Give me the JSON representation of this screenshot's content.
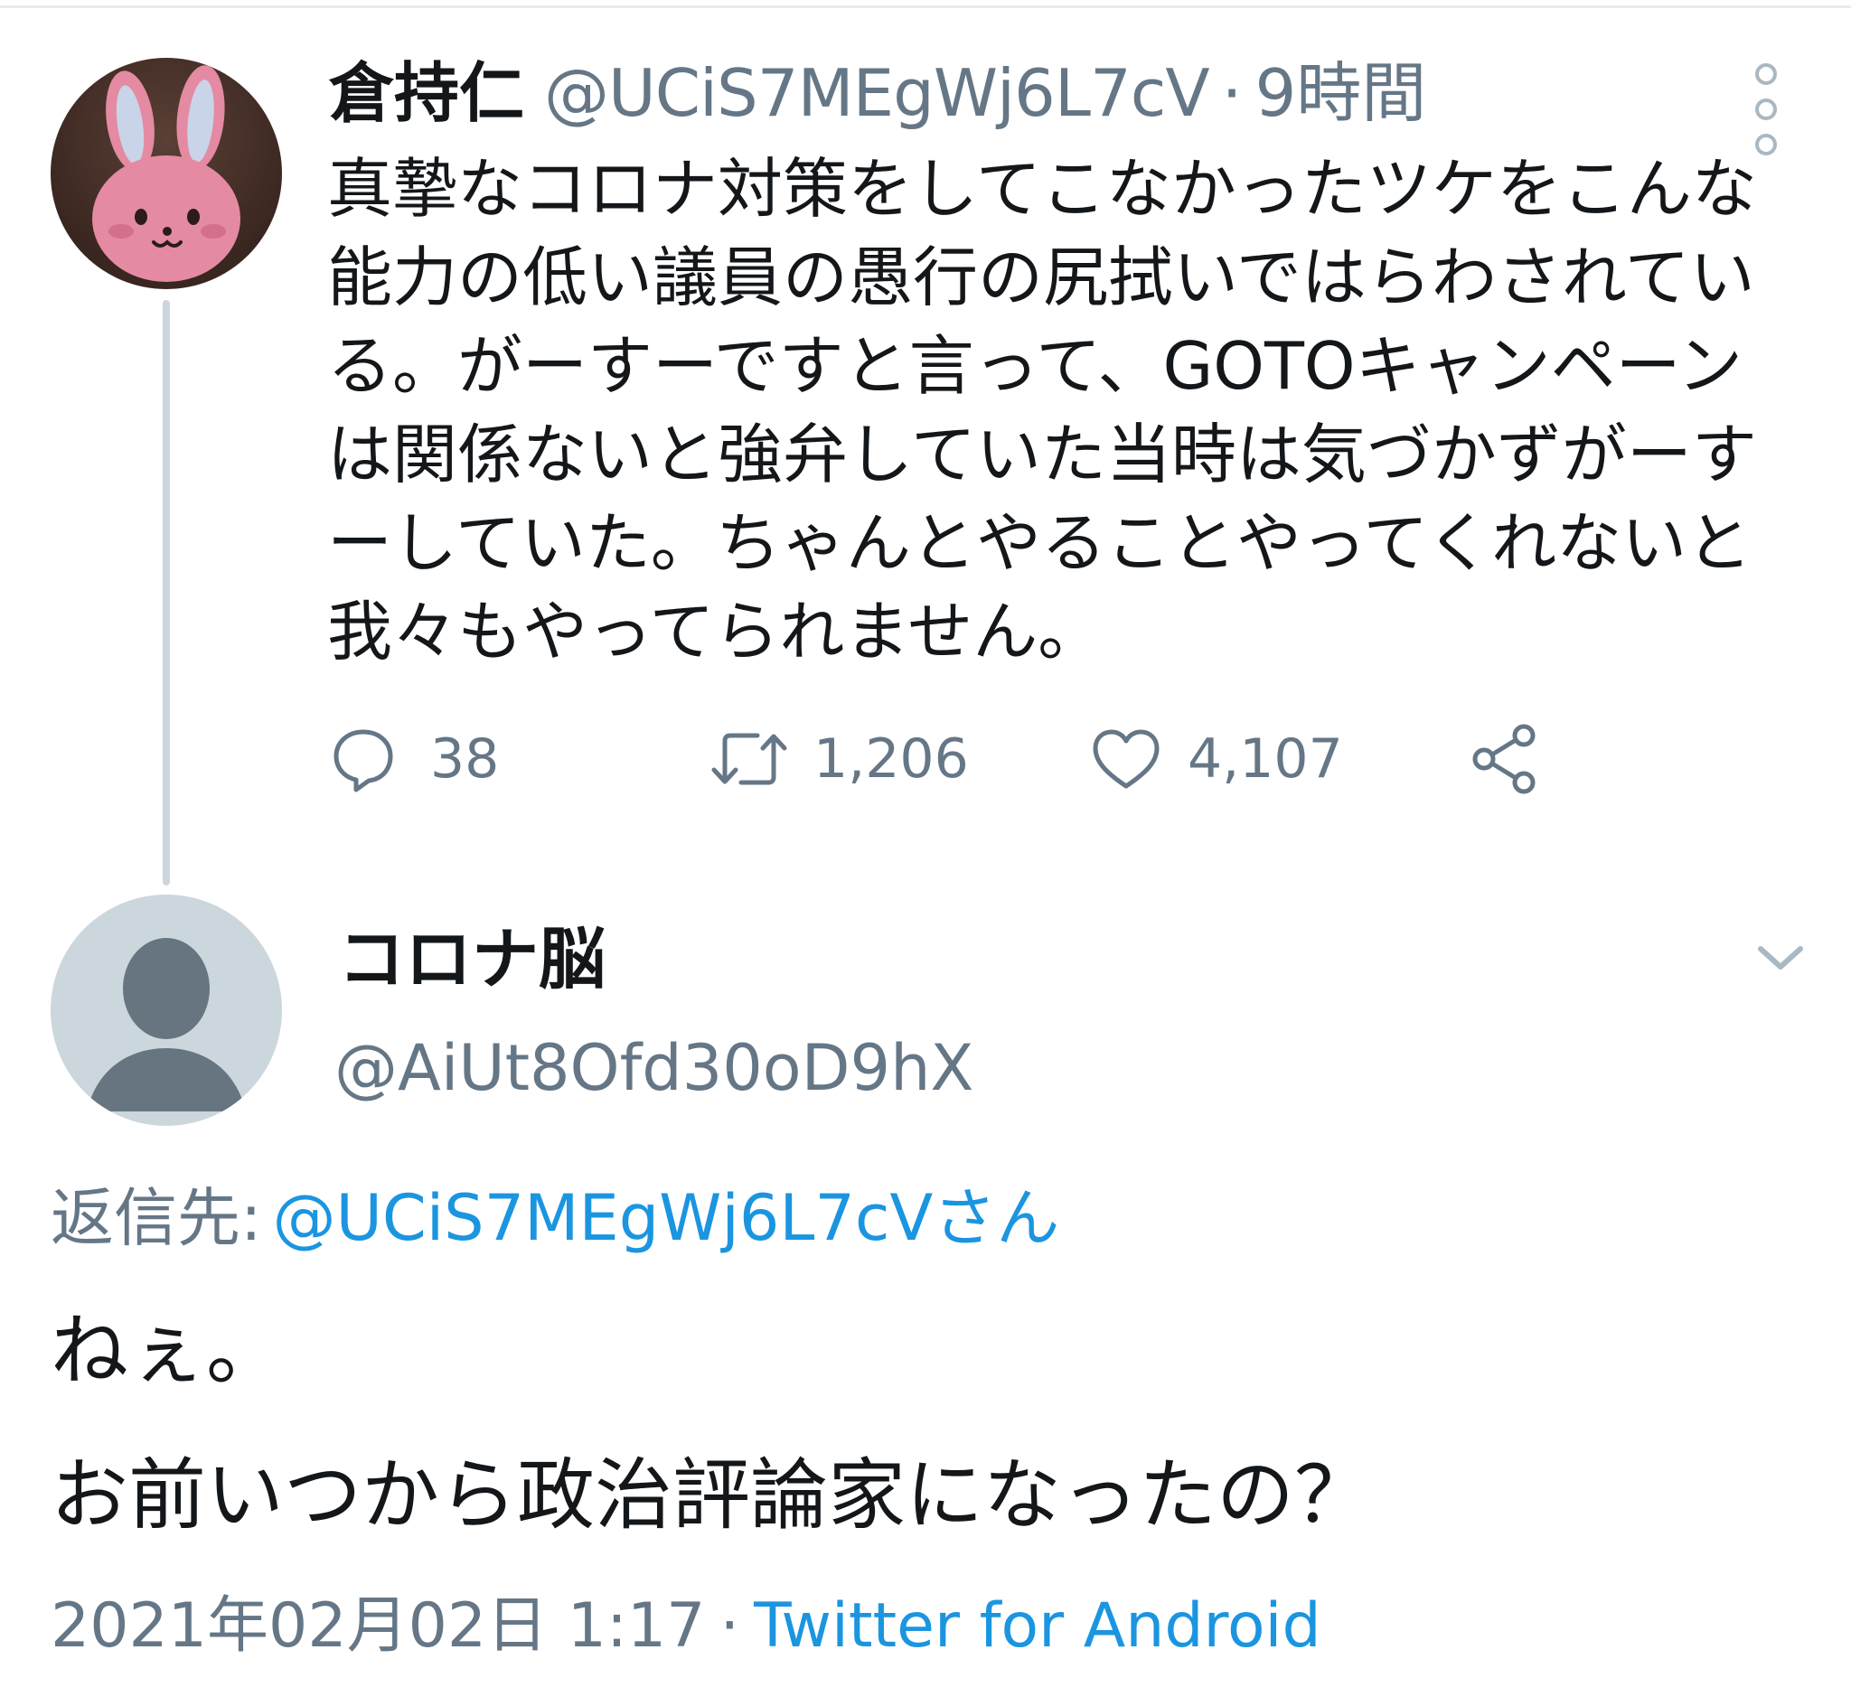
{
  "parent_tweet": {
    "name": "倉持仁",
    "handle": "@UCiS7MEgWj6L7cV",
    "separator": "·",
    "time": "9時間",
    "body": "真摯なコロナ対策をしてこなかったツケをこんな能力の低い議員の愚行の尻拭いではらわされている。がーすーですと言って、GOTOキャンペーンは関係ないと強弁していた当時は気づかずがーすーしていた。ちゃんとやることやってくれないと我々もやってられません。",
    "actions": {
      "reply_count": "38",
      "retweet_count": "1,206",
      "like_count": "4,107"
    },
    "icons": {
      "avatar": "pink-rabbit-avatar",
      "more": "more-vertical-icon",
      "reply": "reply-bubble-icon",
      "retweet": "retweet-icon",
      "like": "heart-icon",
      "share": "share-icon"
    }
  },
  "reply_tweet": {
    "name": "コロナ脳",
    "handle": "@AiUt8Ofd30oD9hX",
    "reply_to_label": "返信先:",
    "reply_to_target": "@UCiS7MEgWj6L7cVさん",
    "body_line_1": "ねぇ。",
    "body_line_2": "お前いつから政治評論家になったの？",
    "date": "2021年02月02日 1:17",
    "separator": "·",
    "source": "Twitter for Android",
    "icons": {
      "avatar": "default-user-avatar",
      "chevron": "chevron-down-icon"
    }
  },
  "colors": {
    "text_primary": "#14171a",
    "text_secondary": "#657786",
    "link": "#1b95e0",
    "thread_line": "#ccd6dd",
    "default_avatar_bg": "#ccd6dd",
    "default_avatar_figure": "#66757f",
    "rabbit_pink": "#e48aa3"
  }
}
